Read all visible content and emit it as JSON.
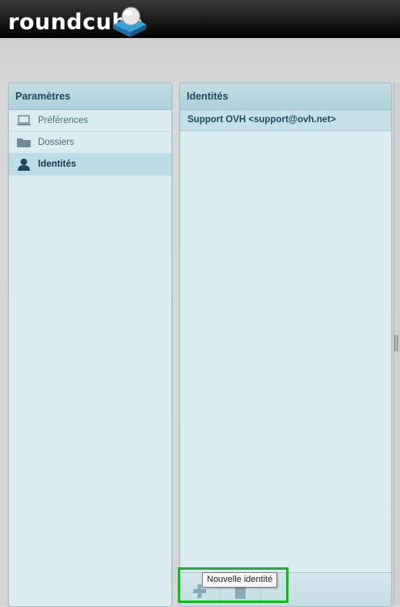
{
  "header": {
    "logo_text": "roundcube"
  },
  "settings": {
    "title": "Paramètres",
    "items": [
      {
        "label": "Préférences",
        "icon": "laptop-icon",
        "selected": false
      },
      {
        "label": "Dossiers",
        "icon": "folder-icon",
        "selected": false
      },
      {
        "label": "Identités",
        "icon": "user-icon",
        "selected": true
      }
    ]
  },
  "identities": {
    "title": "Identités",
    "rows": [
      {
        "label": "Support OVH <support@ovh.net>"
      }
    ]
  },
  "footer": {
    "add_tooltip": "Nouvelle identité"
  },
  "colors": {
    "highlight": "#22b02a",
    "panel": "#dbecf1",
    "header_text": "#1f4a5a"
  }
}
